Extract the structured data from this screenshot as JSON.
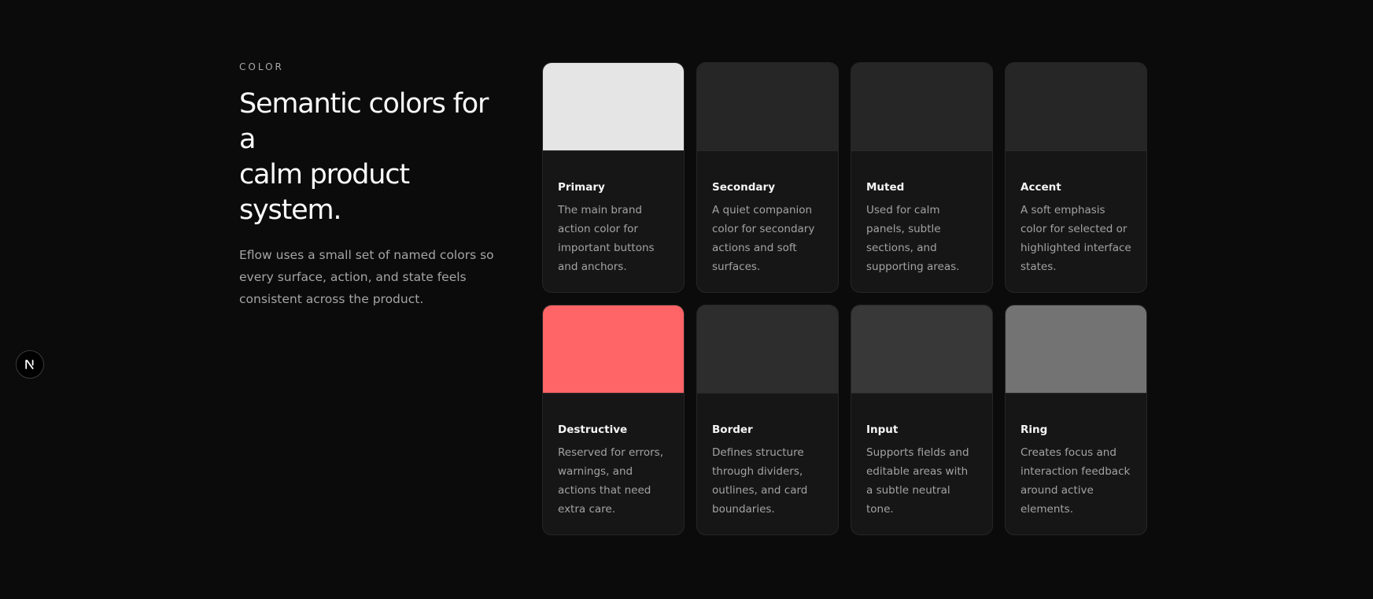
{
  "section": {
    "eyebrow": "COLOR",
    "title_line1": "Semantic colors for a",
    "title_line2": "calm product system.",
    "description": "Eflow uses a small set of named colors so every surface, action, and state feels consistent across the product."
  },
  "colors": [
    {
      "name": "Primary",
      "description": "The main brand action color for important buttons and anchors.",
      "swatch": "#e5e5e5"
    },
    {
      "name": "Secondary",
      "description": "A quiet companion color for secondary actions and soft surfaces.",
      "swatch": "#262626"
    },
    {
      "name": "Muted",
      "description": "Used for calm panels, subtle sections, and supporting areas.",
      "swatch": "#262626"
    },
    {
      "name": "Accent",
      "description": "A soft emphasis color for selected or highlighted interface states.",
      "swatch": "#262626"
    },
    {
      "name": "Destructive",
      "description": "Reserved for errors, warnings, and actions that need extra care.",
      "swatch": "#ff6467"
    },
    {
      "name": "Border",
      "description": "Defines structure through dividers, outlines, and card boundaries.",
      "swatch": "#2d2d2d"
    },
    {
      "name": "Input",
      "description": "Supports fields and editable areas with a subtle neutral tone.",
      "swatch": "#383838"
    },
    {
      "name": "Ring",
      "description": "Creates focus and interaction feedback around active elements.",
      "swatch": "#737373"
    }
  ],
  "floating_button": {
    "label": "N",
    "icon": "nextjs-logo-icon"
  }
}
